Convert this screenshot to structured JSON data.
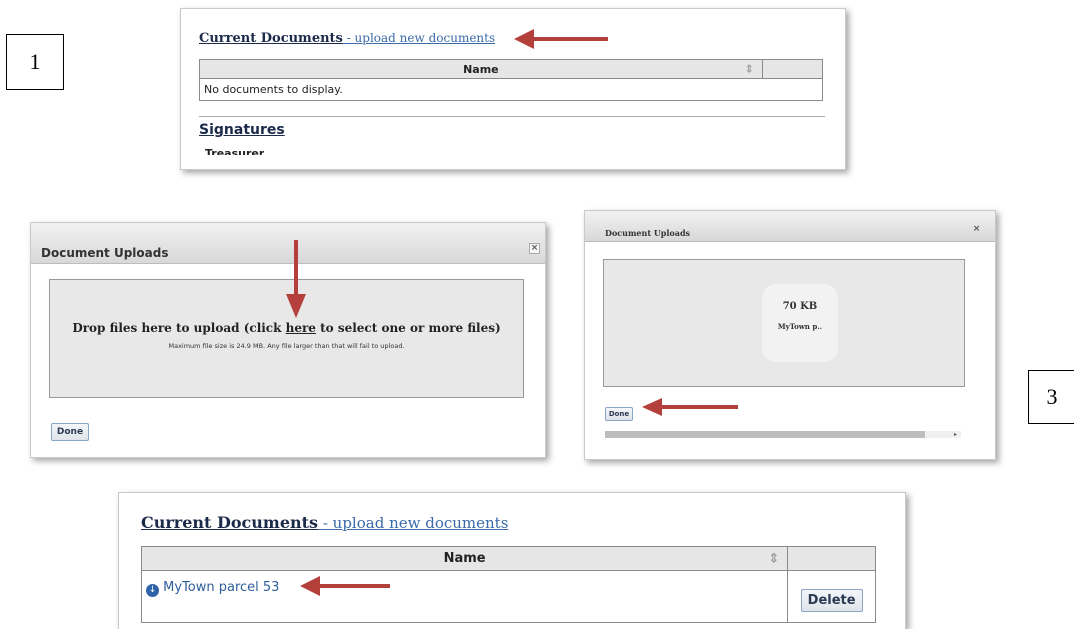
{
  "steps": {
    "one": "1",
    "three": "3"
  },
  "panel1": {
    "title": "Current Documents",
    "link": " - upload new documents",
    "column_name": "Name",
    "empty_message": "No documents to display.",
    "signatures_heading": "Signatures",
    "treasurer_label": "Treasurer"
  },
  "dialog2": {
    "header": "Document Uploads",
    "close": "×",
    "drop_before": "Drop files here to upload (click ",
    "drop_link": "here",
    "drop_after": " to select one or more files)",
    "drop_note": "Maximum file size is 24.9 MB. Any file larger than that will fail to upload.",
    "done": "Done"
  },
  "dialog3": {
    "header": "Document Uploads",
    "close": "×",
    "file_size": "70 KB",
    "file_name": "MyTown p..",
    "done": "Done"
  },
  "panel4": {
    "title": "Current Documents",
    "link": " - upload new documents",
    "column_name": "Name",
    "row_file": "MyTown parcel 53",
    "delete": "Delete"
  },
  "colors": {
    "arrow": "#b3403a",
    "link": "#3a6aa8",
    "title": "#1c2a4a"
  },
  "icons": [
    "sort-icon",
    "download-icon",
    "close-icon",
    "arrow-annotation"
  ]
}
